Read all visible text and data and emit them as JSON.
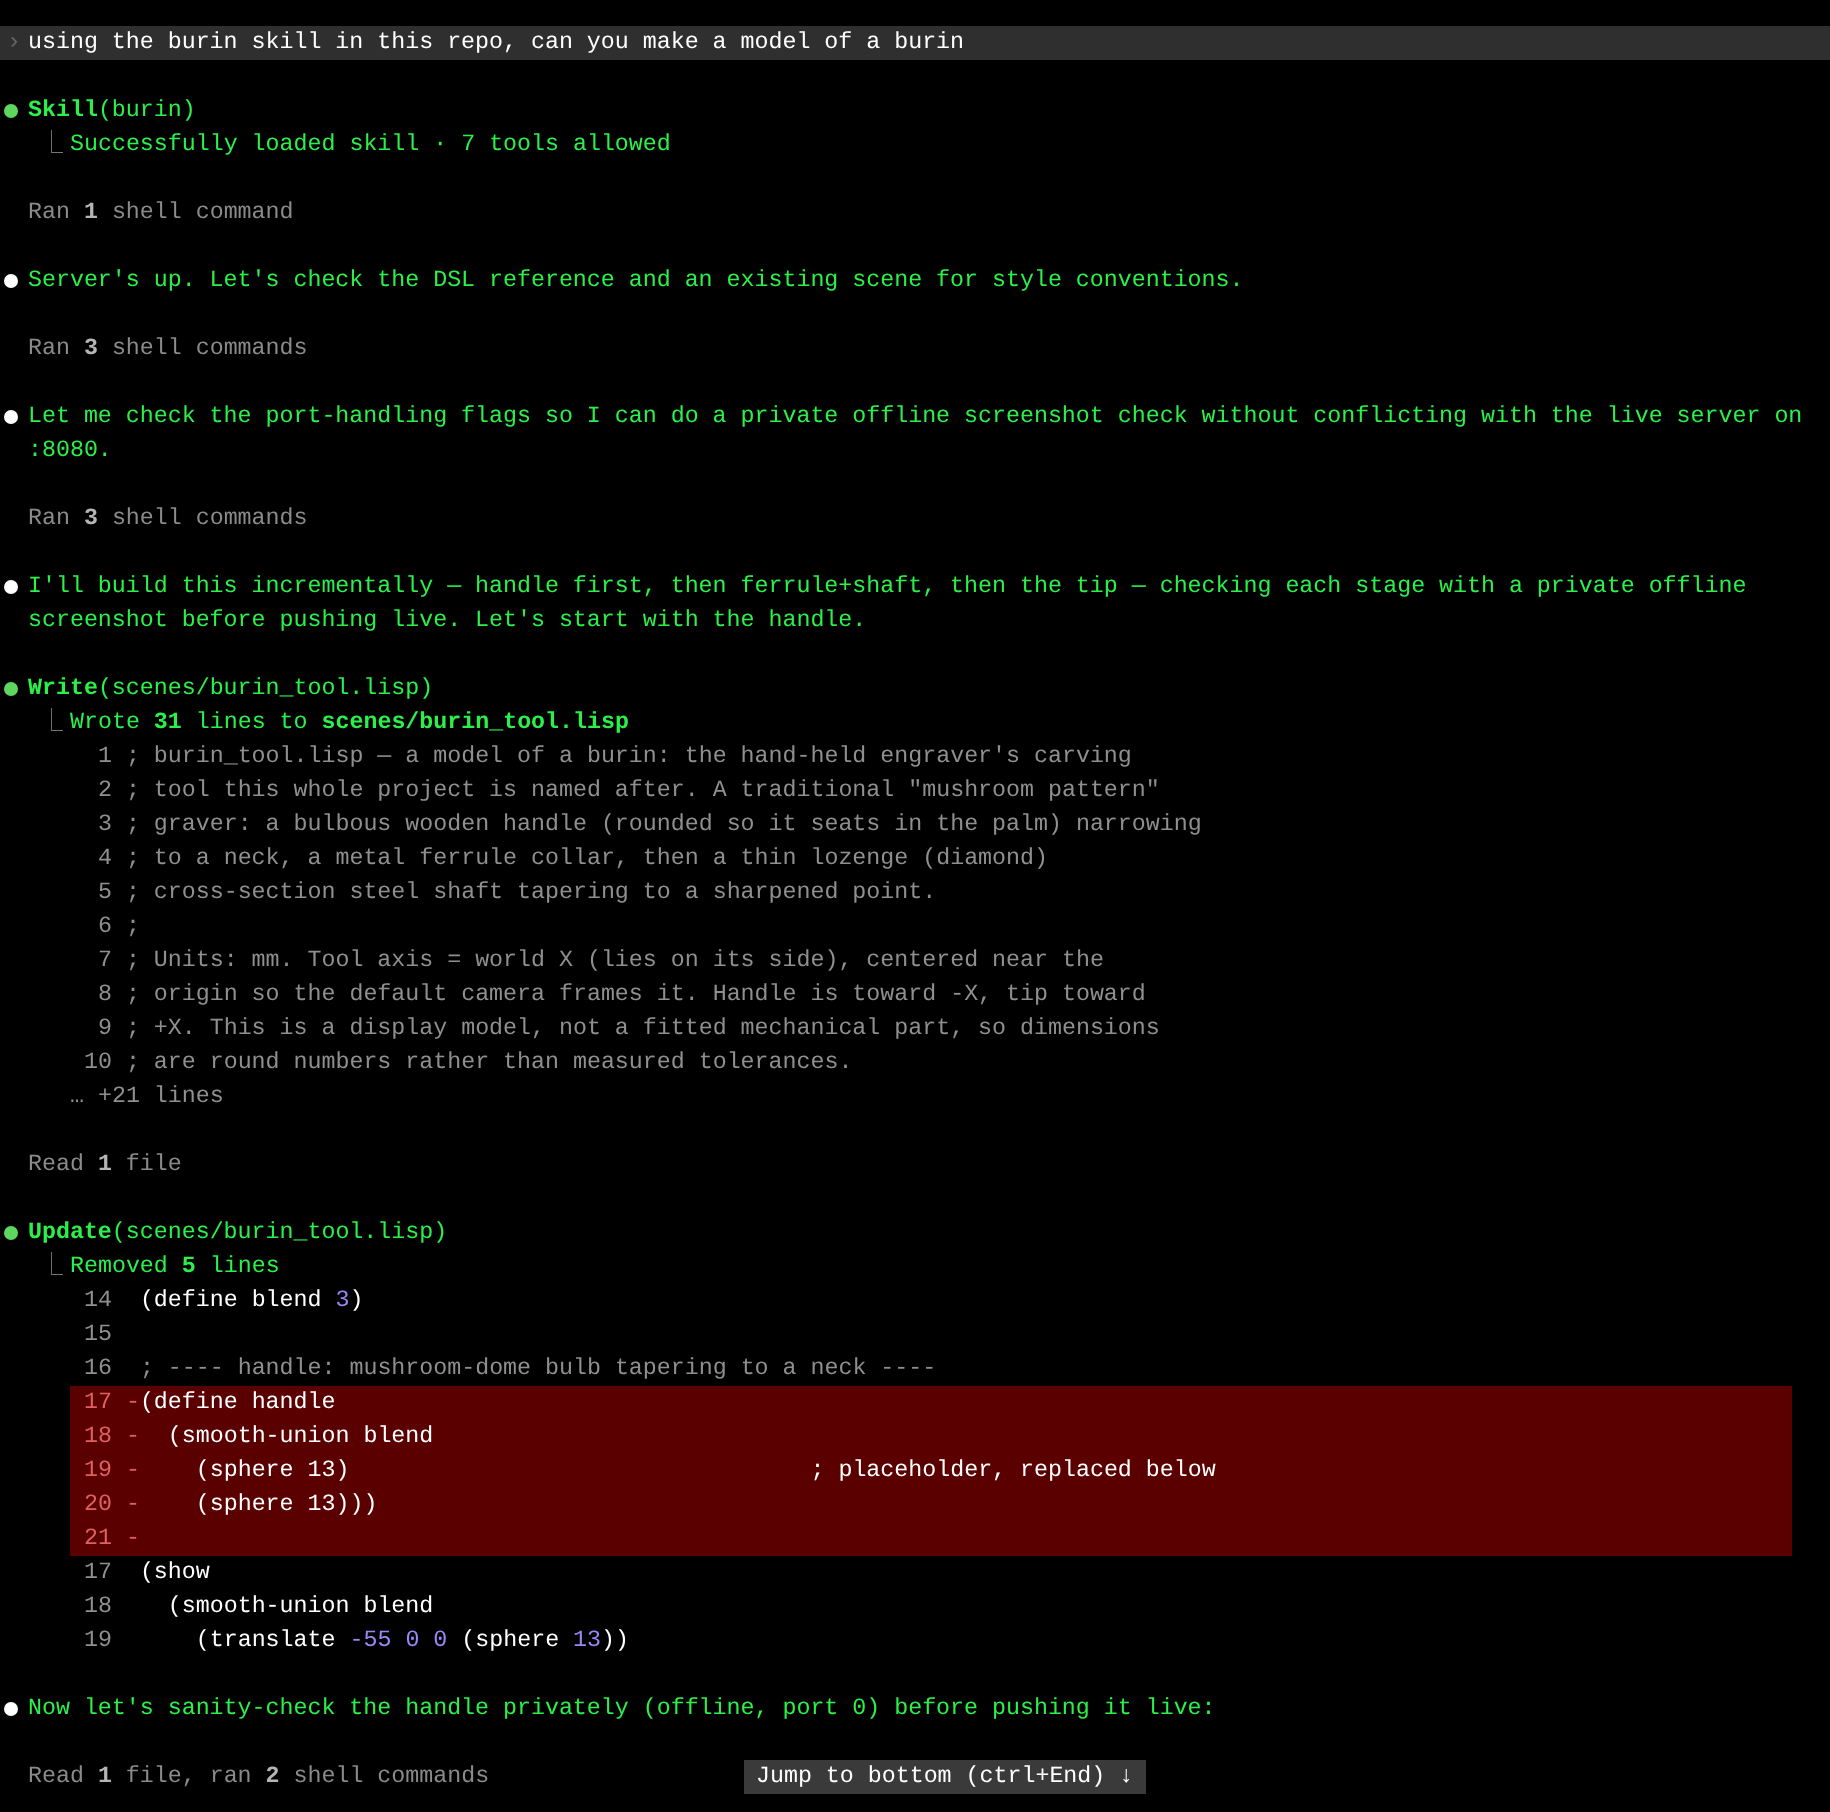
{
  "prompt": {
    "chevron": "›",
    "text": "using the burin skill in this repo, can you make a model of a burin"
  },
  "blocks": [
    {
      "kind": "tool",
      "title": "**Skill**(burin)",
      "result_mark": "⎿",
      "result": "Successfully loaded skill · 7 tools allowed"
    },
    {
      "kind": "summary",
      "text": "Ran **1** shell command"
    },
    {
      "kind": "message",
      "text": "Server's up. Let's check the DSL reference and an existing scene for style conventions."
    },
    {
      "kind": "summary",
      "text": "Ran **3** shell commands"
    },
    {
      "kind": "message",
      "text": "Let me check the port-handling flags so I can do a private offline screenshot check without conflicting with the live server on :8080."
    },
    {
      "kind": "summary",
      "text": "Ran **3** shell commands"
    },
    {
      "kind": "message",
      "text": "I'll build this incrementally — handle first, then ferrule+shaft, then the tip — checking each stage with a private offline screenshot before pushing live. Let's start with the handle."
    },
    {
      "kind": "tool",
      "title": "**Write**(scenes/burin_tool.lisp)",
      "result_mark": "⎿",
      "result": "Wrote **31** lines to **scenes/burin_tool.lisp**",
      "code": [
        {
          "number": "1",
          "text": "; burin_tool.lisp — a model of a burin: the hand-held engraver's carving"
        },
        {
          "number": "2",
          "text": "; tool this whole project is named after. A traditional \"mushroom pattern\""
        },
        {
          "number": "3",
          "text": "; graver: a bulbous wooden handle (rounded so it seats in the palm) narrowing"
        },
        {
          "number": "4",
          "text": "; to a neck, a metal ferrule collar, then a thin lozenge (diamond)"
        },
        {
          "number": "5",
          "text": "; cross-section steel shaft tapering to a sharpened point."
        },
        {
          "number": "6",
          "text": ";"
        },
        {
          "number": "7",
          "text": "; Units: mm. Tool axis = world X (lies on its side), centered near the"
        },
        {
          "number": "8",
          "text": "; origin so the default camera frames it. Handle is toward -X, tip toward"
        },
        {
          "number": "9",
          "text": "; +X. This is a display model, not a fitted mechanical part, so dimensions"
        },
        {
          "number": "10",
          "text": "; are round numbers rather than measured tolerances."
        }
      ],
      "more": "… +21 lines"
    },
    {
      "kind": "summary",
      "text": "Read **1** file"
    },
    {
      "kind": "tool",
      "title": "**Update**(scenes/burin_tool.lisp)",
      "result_mark": "⎿",
      "result": "Removed **5** lines",
      "diff": [
        {
          "number": "14",
          "kind": "context",
          "segments": [
            {
              "kind": "plain",
              "text": "(define blend "
            },
            {
              "kind": "number",
              "text": "3"
            },
            {
              "kind": "plain",
              "text": ")"
            }
          ]
        },
        {
          "number": "15",
          "kind": "context"
        },
        {
          "number": "16",
          "kind": "context",
          "segments": [
            {
              "kind": "comment",
              "text": "; ---- handle: mushroom-dome bulb tapering to a neck ----"
            }
          ]
        },
        {
          "number": "17",
          "kind": "removed",
          "marker": "-",
          "segments": [
            {
              "kind": "plain",
              "text": "(define handle"
            }
          ]
        },
        {
          "number": "18",
          "kind": "removed",
          "marker": "-",
          "segments": [
            {
              "kind": "plain",
              "text": "  (smooth-union blend"
            }
          ]
        },
        {
          "number": "19",
          "kind": "removed",
          "marker": "-",
          "segments": [
            {
              "kind": "plain",
              "text": "    (sphere 13)                                 ; placeholder, replaced below"
            }
          ]
        },
        {
          "number": "20",
          "kind": "removed",
          "marker": "-",
          "segments": [
            {
              "kind": "plain",
              "text": "    (sphere 13)))"
            }
          ]
        },
        {
          "number": "21",
          "kind": "removed",
          "marker": "-"
        },
        {
          "number": "17",
          "kind": "context",
          "segments": [
            {
              "kind": "plain",
              "text": "(show"
            }
          ]
        },
        {
          "number": "18",
          "kind": "context",
          "segments": [
            {
              "kind": "plain",
              "text": "  (smooth-union blend"
            }
          ]
        },
        {
          "number": "19",
          "kind": "context",
          "segments": [
            {
              "kind": "plain",
              "text": "    (translate "
            },
            {
              "kind": "number",
              "text": "-55"
            },
            {
              "kind": "number",
              "text": " 0"
            },
            {
              "kind": "number",
              "text": " 0"
            },
            {
              "kind": "plain",
              "text": " (sphere "
            },
            {
              "kind": "number",
              "text": "13"
            },
            {
              "kind": "plain",
              "text": "))"
            }
          ]
        }
      ]
    },
    {
      "kind": "message",
      "text": "Now let's sanity-check the handle privately (offline, port 0) before pushing it live:"
    },
    {
      "kind": "summary",
      "text": "Read **1** file, ran **2** shell commands"
    }
  ],
  "jump_button": {
    "label": "Jump to bottom (ctrl+End) ↓"
  }
}
